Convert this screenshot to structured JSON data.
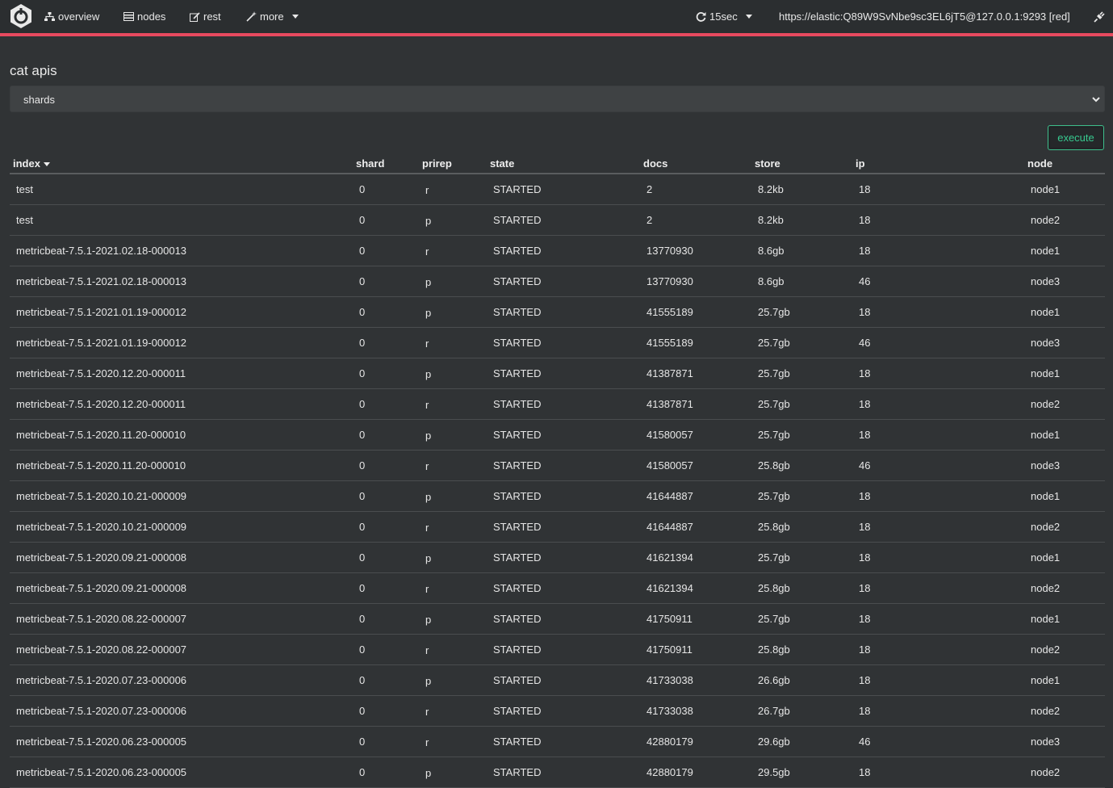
{
  "nav": {
    "items": [
      {
        "label": "overview",
        "icon": "sitemap-icon"
      },
      {
        "label": "nodes",
        "icon": "server-icon"
      },
      {
        "label": "rest",
        "icon": "edit-icon"
      },
      {
        "label": "more",
        "icon": "magic-wand-icon"
      }
    ],
    "refresh_label": "15sec",
    "connection_url": "https://elastic:Q89W9SvNbe9sc3EL6jT5@127.0.0.1:9293 [red]",
    "status_color": "#e84a5f"
  },
  "page": {
    "title": "cat apis",
    "api_select_value": "shards",
    "execute_label": "execute"
  },
  "table": {
    "columns": [
      "index",
      "shard",
      "prirep",
      "state",
      "docs",
      "store",
      "ip",
      "node"
    ],
    "rows": [
      [
        "test",
        "0",
        "r",
        "STARTED",
        "2",
        "8.2kb",
        "18",
        "node1"
      ],
      [
        "test",
        "0",
        "p",
        "STARTED",
        "2",
        "8.2kb",
        "18",
        "node2"
      ],
      [
        "metricbeat-7.5.1-2021.02.18-000013",
        "0",
        "r",
        "STARTED",
        "13770930",
        "8.6gb",
        "18",
        "node1"
      ],
      [
        "metricbeat-7.5.1-2021.02.18-000013",
        "0",
        "p",
        "STARTED",
        "13770930",
        "8.6gb",
        "46",
        "node3"
      ],
      [
        "metricbeat-7.5.1-2021.01.19-000012",
        "0",
        "p",
        "STARTED",
        "41555189",
        "25.7gb",
        "18",
        "node1"
      ],
      [
        "metricbeat-7.5.1-2021.01.19-000012",
        "0",
        "r",
        "STARTED",
        "41555189",
        "25.7gb",
        "46",
        "node3"
      ],
      [
        "metricbeat-7.5.1-2020.12.20-000011",
        "0",
        "p",
        "STARTED",
        "41387871",
        "25.7gb",
        "18",
        "node1"
      ],
      [
        "metricbeat-7.5.1-2020.12.20-000011",
        "0",
        "r",
        "STARTED",
        "41387871",
        "25.7gb",
        "18",
        "node2"
      ],
      [
        "metricbeat-7.5.1-2020.11.20-000010",
        "0",
        "p",
        "STARTED",
        "41580057",
        "25.7gb",
        "18",
        "node1"
      ],
      [
        "metricbeat-7.5.1-2020.11.20-000010",
        "0",
        "r",
        "STARTED",
        "41580057",
        "25.8gb",
        "46",
        "node3"
      ],
      [
        "metricbeat-7.5.1-2020.10.21-000009",
        "0",
        "p",
        "STARTED",
        "41644887",
        "25.7gb",
        "18",
        "node1"
      ],
      [
        "metricbeat-7.5.1-2020.10.21-000009",
        "0",
        "r",
        "STARTED",
        "41644887",
        "25.8gb",
        "18",
        "node2"
      ],
      [
        "metricbeat-7.5.1-2020.09.21-000008",
        "0",
        "p",
        "STARTED",
        "41621394",
        "25.7gb",
        "18",
        "node1"
      ],
      [
        "metricbeat-7.5.1-2020.09.21-000008",
        "0",
        "r",
        "STARTED",
        "41621394",
        "25.8gb",
        "18",
        "node2"
      ],
      [
        "metricbeat-7.5.1-2020.08.22-000007",
        "0",
        "p",
        "STARTED",
        "41750911",
        "25.7gb",
        "18",
        "node1"
      ],
      [
        "metricbeat-7.5.1-2020.08.22-000007",
        "0",
        "r",
        "STARTED",
        "41750911",
        "25.8gb",
        "18",
        "node2"
      ],
      [
        "metricbeat-7.5.1-2020.07.23-000006",
        "0",
        "p",
        "STARTED",
        "41733038",
        "26.6gb",
        "18",
        "node1"
      ],
      [
        "metricbeat-7.5.1-2020.07.23-000006",
        "0",
        "r",
        "STARTED",
        "41733038",
        "26.7gb",
        "18",
        "node2"
      ],
      [
        "metricbeat-7.5.1-2020.06.23-000005",
        "0",
        "r",
        "STARTED",
        "42880179",
        "29.6gb",
        "46",
        "node3"
      ],
      [
        "metricbeat-7.5.1-2020.06.23-000005",
        "0",
        "p",
        "STARTED",
        "42880179",
        "29.5gb",
        "18",
        "node2"
      ]
    ]
  }
}
